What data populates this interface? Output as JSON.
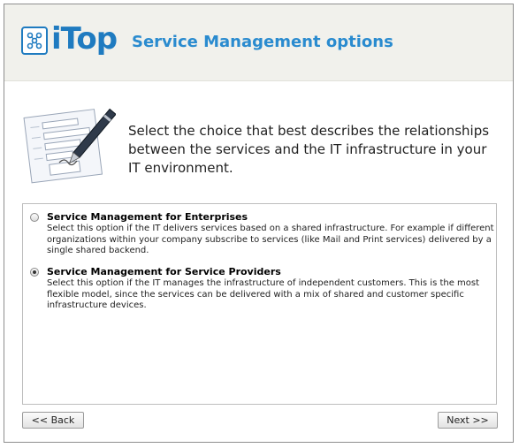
{
  "header": {
    "logo_text": "iTop",
    "title": "Service Management options"
  },
  "intro": {
    "text": "Select the choice that best describes the relationships between the services and the IT infrastructure in your IT environment."
  },
  "options": [
    {
      "title": "Service Management for Enterprises",
      "description": "Select this option if the IT delivers services based on a shared infrastructure. For example if different organizations within your company subscribe to services (like Mail and Print services) delivered by a single shared backend.",
      "selected": false
    },
    {
      "title": "Service Management for Service Providers",
      "description": "Select this option if the IT manages the infrastructure of independent customers. This is the most flexible model, since the services can be delivered with a mix of shared and customer specific infrastructure devices.",
      "selected": true
    }
  ],
  "buttons": {
    "back": "<< Back",
    "next": "Next >>"
  },
  "colors": {
    "brand": "#1f7bc0",
    "title": "#2a8bcf",
    "header_bg": "#f1f1ec"
  },
  "icons": {
    "logo": "itop-logo-icon",
    "illustration": "form-with-pen-icon"
  }
}
